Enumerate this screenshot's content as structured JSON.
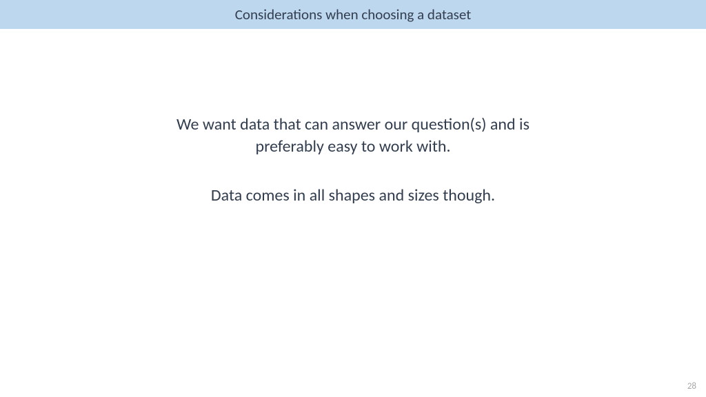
{
  "header": {
    "title": "Considerations when choosing a dataset"
  },
  "content": {
    "paragraph1_line1": "We want data that can answer our question(s) and is",
    "paragraph1_line2": "preferably easy to work with.",
    "paragraph2": "Data comes in all shapes and sizes though."
  },
  "footer": {
    "page_number": "28"
  }
}
